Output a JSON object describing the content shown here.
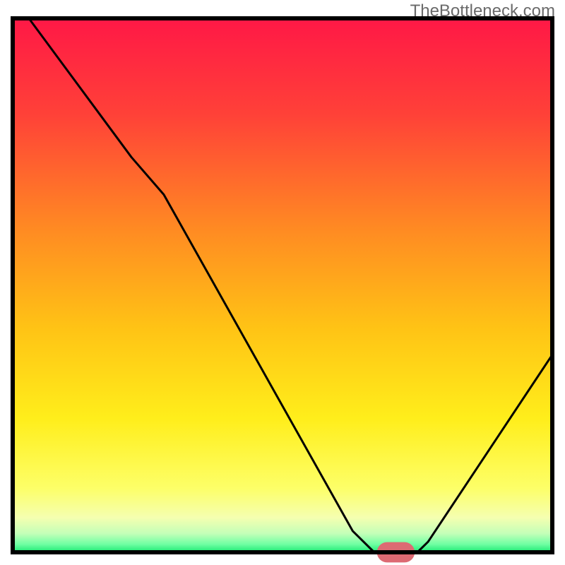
{
  "watermark": "TheBottleneck.com",
  "chart_data": {
    "type": "line",
    "title": "",
    "xlabel": "",
    "ylabel": "",
    "x_range": [
      0,
      100
    ],
    "y_range": [
      0,
      100
    ],
    "curve": [
      {
        "x": 3,
        "y": 100
      },
      {
        "x": 22,
        "y": 74
      },
      {
        "x": 28,
        "y": 67
      },
      {
        "x": 63,
        "y": 4
      },
      {
        "x": 67,
        "y": 0
      },
      {
        "x": 75,
        "y": 0
      },
      {
        "x": 77,
        "y": 2
      },
      {
        "x": 100,
        "y": 37
      }
    ],
    "marker": {
      "x": 71,
      "y": 0,
      "width": 7,
      "height": 2.2,
      "color": "#dd6a73"
    },
    "baseline_y": 0,
    "gradient_stops": [
      {
        "offset": 0.0,
        "color": "#ff1846"
      },
      {
        "offset": 0.18,
        "color": "#ff4138"
      },
      {
        "offset": 0.4,
        "color": "#ff8c22"
      },
      {
        "offset": 0.58,
        "color": "#ffc315"
      },
      {
        "offset": 0.75,
        "color": "#ffee1b"
      },
      {
        "offset": 0.88,
        "color": "#fdff68"
      },
      {
        "offset": 0.935,
        "color": "#f5ffb0"
      },
      {
        "offset": 0.965,
        "color": "#c3ffb8"
      },
      {
        "offset": 0.985,
        "color": "#6fffa3"
      },
      {
        "offset": 1.0,
        "color": "#19e871"
      }
    ],
    "border_color": "#000000",
    "curve_color": "#000000"
  }
}
